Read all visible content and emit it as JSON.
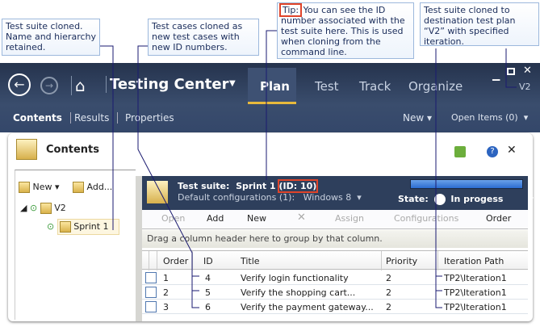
{
  "callouts": {
    "c1": "Test suite cloned. Name and hierarchy retained.",
    "c2": "Test cases cloned as new test cases with new ID numbers.",
    "c3_tip": "Tip:",
    "c3": "You can see the ID number associated with the test suite here. This is used when cloning from the command line.",
    "c4": "Test suite cloned to destination test plan “V2” with specified iteration."
  },
  "header": {
    "title": "Testing Center",
    "tabs": [
      "Plan",
      "Test",
      "Track",
      "Organize"
    ],
    "project": "V2"
  },
  "subnav": {
    "items": [
      "Contents",
      "Results",
      "Properties"
    ],
    "new": "New",
    "open_items": "Open Items (0)"
  },
  "panel": {
    "title": "Contents"
  },
  "tree": {
    "new": "New",
    "add": "Add...",
    "nodes": [
      "V2",
      "Sprint 1"
    ]
  },
  "suite": {
    "label": "Test suite:",
    "name": "Sprint 1",
    "id": "(ID: 10)",
    "configs_label": "Default configurations (1):",
    "configs": "Windows 8",
    "state_label": "State:",
    "state": "In progess"
  },
  "toolbar": [
    "Open",
    "Add",
    "New",
    "Assign",
    "Configurations",
    "Order"
  ],
  "group_hint": "Drag a column header here to group by that column.",
  "columns": [
    "Order",
    "ID",
    "Title",
    "Priority",
    "Iteration Path"
  ],
  "rows": [
    {
      "order": "1",
      "id": "4",
      "title": "Verify login functionality",
      "priority": "2",
      "path": "TP2\\Iteration1"
    },
    {
      "order": "2",
      "id": "5",
      "title": "Verify the shopping cart...",
      "priority": "2",
      "path": "TP2\\Iteration1"
    },
    {
      "order": "3",
      "id": "6",
      "title": "Verify the payment gateway...",
      "priority": "2",
      "path": "TP2\\Iteration1"
    }
  ]
}
